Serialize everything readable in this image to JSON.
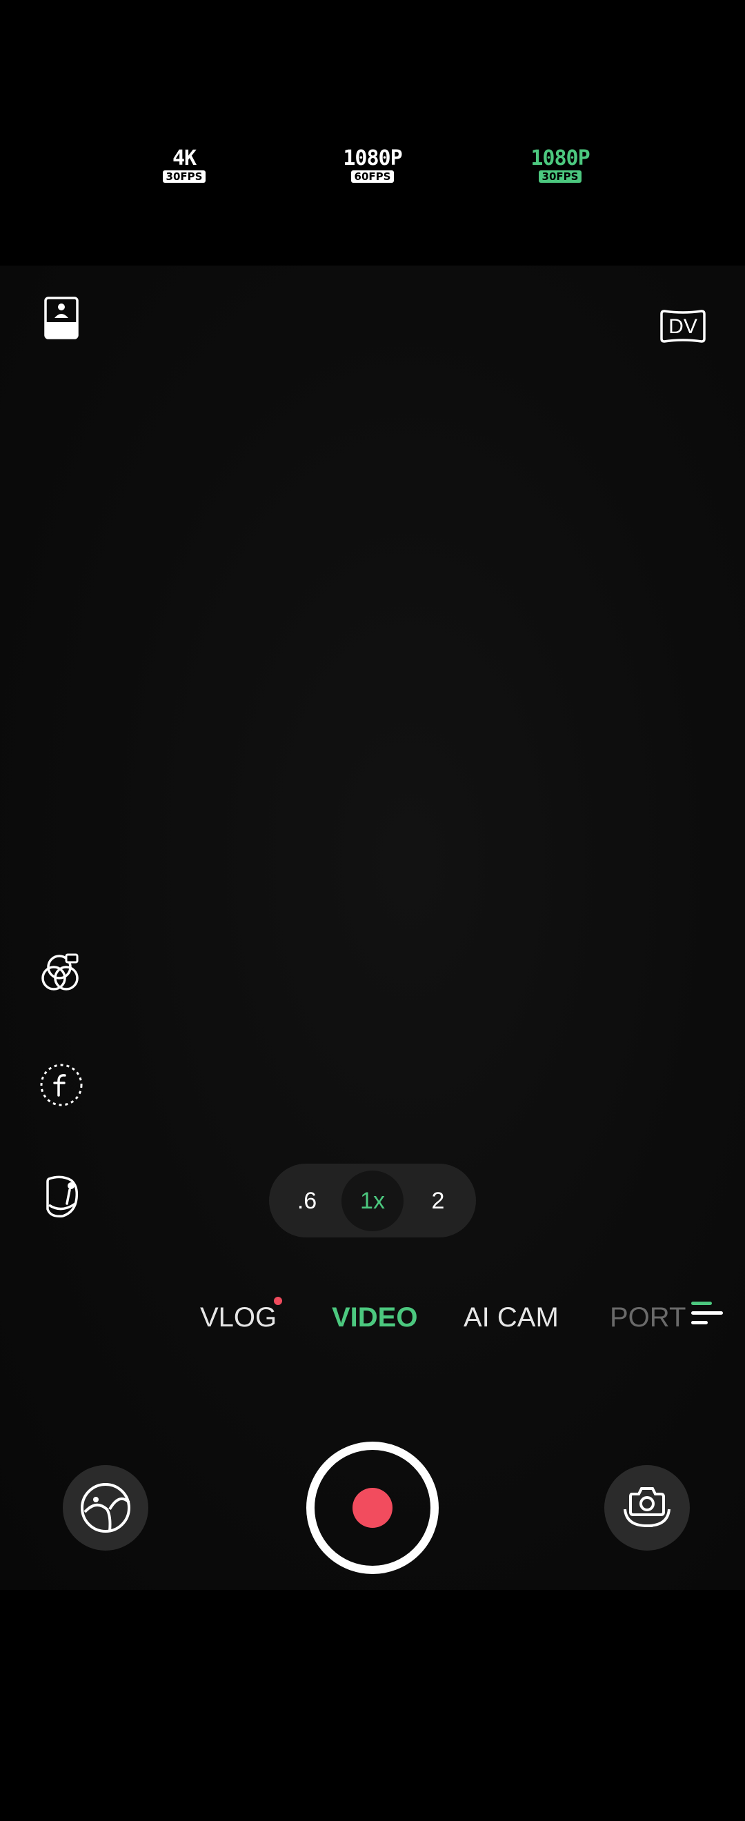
{
  "resolutions": [
    {
      "label": "4K",
      "fps": "30FPS",
      "active": false
    },
    {
      "label": "1080P",
      "fps": "60FPS",
      "active": false
    },
    {
      "label": "1080P",
      "fps": "30FPS",
      "active": true
    }
  ],
  "top_controls": {
    "left_icon": "portrait-frame-icon",
    "dv_label": "DV"
  },
  "side_controls": [
    "filter-icon",
    "flash-auto-icon",
    "face-mic-icon"
  ],
  "zoom": {
    "options": [
      ".6",
      "1x",
      "2"
    ],
    "selected": "1x"
  },
  "modes": {
    "items": [
      "VLOG",
      "VIDEO",
      "AI CAM",
      "PORT"
    ],
    "selected": "VIDEO",
    "new_badge_on": "VLOG"
  },
  "bottom": {
    "gallery_icon": "gallery-icon",
    "record_icon": "record-icon",
    "switch_icon": "switch-camera-icon"
  },
  "colors": {
    "accent": "#4cc87f",
    "record": "#f24c5e",
    "background": "#000000"
  }
}
